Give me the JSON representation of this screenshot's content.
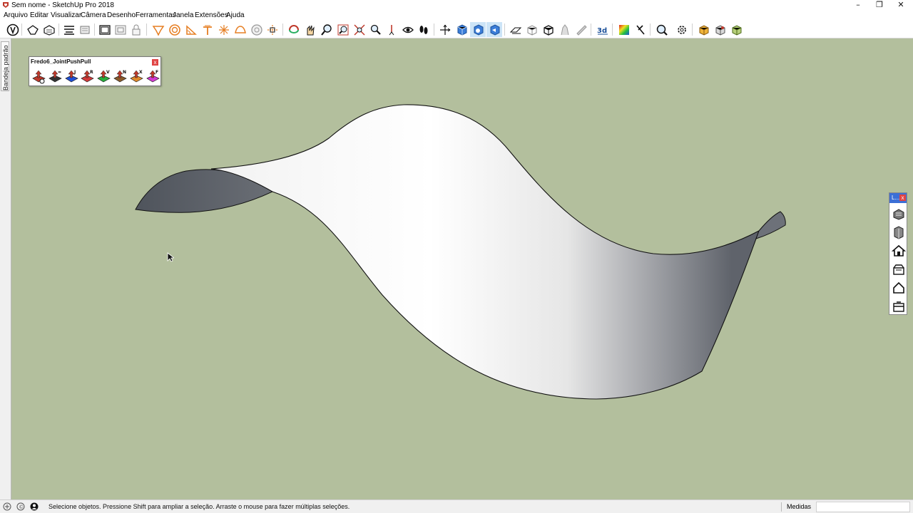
{
  "window": {
    "title": "Sem nome - SketchUp Pro 2018",
    "minimize_glyph": "–",
    "restore_glyph": "❐",
    "close_glyph": "✕"
  },
  "menu": [
    "Arquivo",
    "Editar",
    "Visualizar",
    "Câmera",
    "Desenho",
    "Ferramentas",
    "Janela",
    "Extensões",
    "Ajuda"
  ],
  "toolbar": {
    "tools": [
      "select-tool",
      "eraser-tool",
      "paint-bucket-tool",
      "line-tool",
      "rectangle-tool",
      "circle-tool",
      "arc-tool",
      "push-pull-tool",
      "move-tool",
      "rotate-tool",
      "scale-tool",
      "offset-tool",
      "tape-measure-tool",
      "protractor-tool",
      "axes-tool",
      "dimension-tool",
      "text-tool",
      "section-plane-tool",
      "orbit-tool",
      "pan-tool",
      "zoom-tool",
      "zoom-window-tool",
      "zoom-extents-tool",
      "walk-tool",
      "look-around-tool",
      "position-camera-tool",
      "iso-view",
      "top-view",
      "front-view",
      "right-view",
      "back-view",
      "left-view",
      "xray-style",
      "back-edges-style",
      "wireframe-style",
      "hidden-line-style",
      "shaded-style",
      "shaded-textures-style",
      "monochrome-style",
      "3d-warehouse",
      "extension-warehouse",
      "layout-send",
      "components",
      "materials",
      "styles",
      "shadows",
      "fog",
      "scenes",
      "settings"
    ],
    "active": [
      "orbit-tool",
      "pan-tool"
    ]
  },
  "left_tray": {
    "label": "Bandeja padrão"
  },
  "fredo_panel": {
    "title": "Fredo6_JointPushPull",
    "close_label": "x",
    "buttons": [
      {
        "name": "joint-push-pull-settings",
        "color": "#c0392b",
        "letter": ""
      },
      {
        "name": "joint-push-pull-joint",
        "color": "#333333",
        "letter": "="
      },
      {
        "name": "joint-push-pull-vector",
        "color": "#1f4fd6",
        "letter": "J"
      },
      {
        "name": "joint-push-pull-round",
        "color": "#d23b3b",
        "letter": "R"
      },
      {
        "name": "joint-push-pull-vector-green",
        "color": "#27ae3c",
        "letter": "V"
      },
      {
        "name": "joint-push-pull-normal",
        "color": "#8a5a2b",
        "letter": "N"
      },
      {
        "name": "joint-push-pull-extrude",
        "color": "#e08a2c",
        "letter": "X"
      },
      {
        "name": "joint-push-pull-follow",
        "color": "#d43ad4",
        "letter": "F"
      }
    ]
  },
  "right_panel": {
    "title": "L...",
    "close_label": "x",
    "buttons": [
      "layout-camera-icon",
      "layout-section-icon",
      "house-icon",
      "open-box-icon",
      "home-outline-icon",
      "drawer-icon"
    ]
  },
  "status": {
    "message": "Selecione objetos. Pressione Shift para ampliar a seleção. Arraste o mouse para fazer múltiplas seleções.",
    "measure_label": "Medidas",
    "measure_value": ""
  },
  "colors": {
    "viewport_bg": "#b3bf9d",
    "surface_light": "#f4f4f4",
    "surface_dark": "#5b6068",
    "edge": "#111111"
  }
}
